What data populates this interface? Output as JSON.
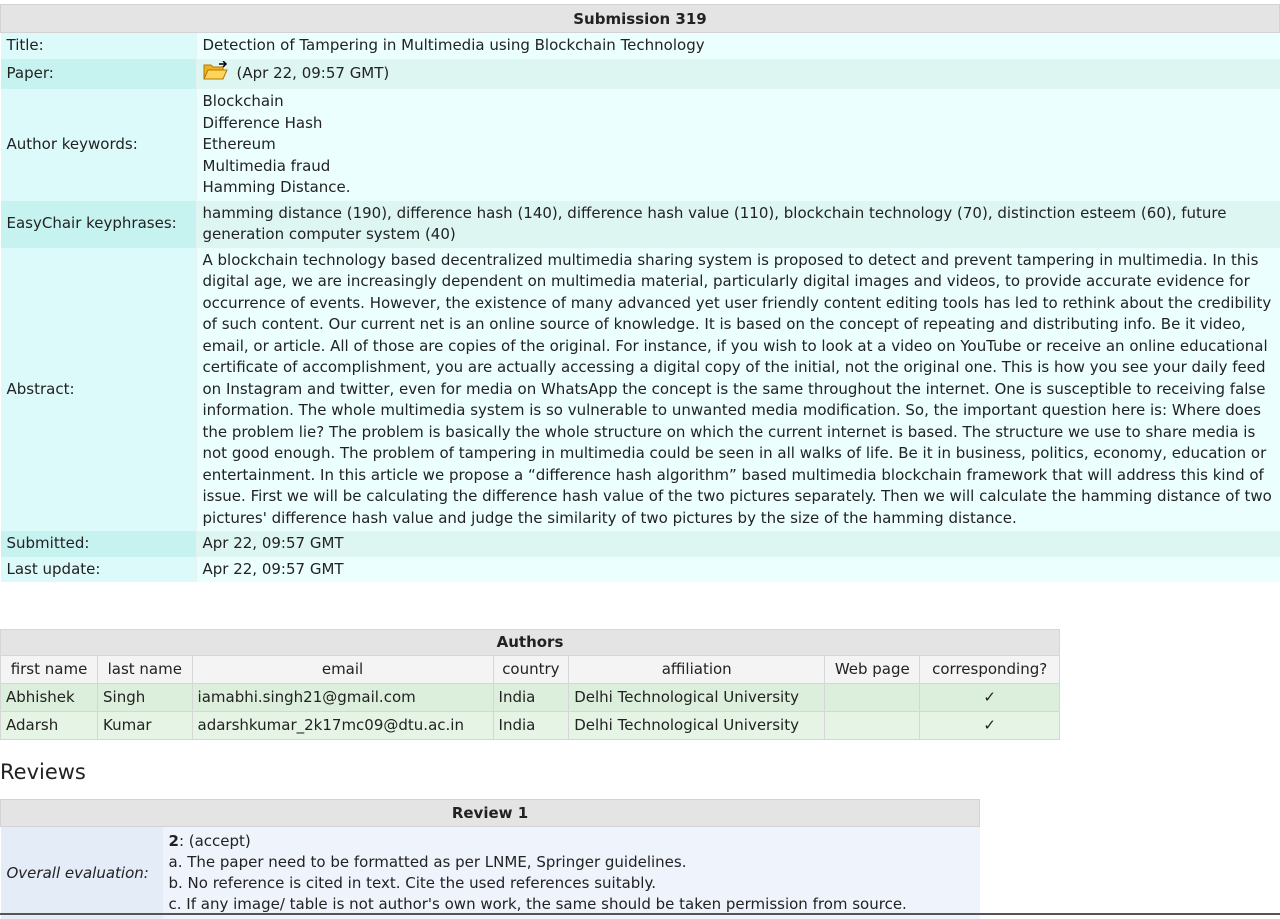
{
  "submission": {
    "title": "Submission 319",
    "fields": {
      "title_label": "Title:",
      "title_value": "Detection of Tampering in Multimedia using Blockchain Technology",
      "paper_label": "Paper:",
      "paper_value": "(Apr 22, 09:57 GMT)",
      "keywords_label": "Author keywords:",
      "keywords": [
        "Blockchain",
        "Difference Hash",
        "Ethereum",
        "Multimedia fraud",
        "Hamming Distance."
      ],
      "keyphrases_label": "EasyChair keyphrases:",
      "keyphrases_value": "hamming distance (190), difference hash (140), difference hash value (110), blockchain technology (70), distinction esteem (60), future generation computer system (40)",
      "abstract_label": "Abstract:",
      "abstract_value": "A blockchain technology based decentralized multimedia sharing system is proposed to detect and prevent tampering in multimedia. In this digital age, we are increasingly dependent on multimedia material, particularly digital images and videos, to provide accurate evidence for occurrence of events. However, the existence of many advanced yet user friendly content editing tools has led to rethink about the credibility of such content. Our current net is an online source of knowledge. It is based on the concept of repeating and distributing info. Be it video, email, or article. All of those are copies of the original. For instance, if you wish to look at a video on YouTube or receive an online educational certificate of accomplishment, you are actually accessing a digital copy of the initial, not the original one. This is how you see your daily feed on Instagram and twitter, even for media on WhatsApp the concept is the same throughout the internet. One is susceptible to receiving false information. The whole multimedia system is so vulnerable to unwanted media modification. So, the important question here is: Where does the problem lie? The problem is basically the whole structure on which the current internet is based. The structure we use to share media is not good enough. The problem of tampering in multimedia could be seen in all walks of life. Be it in business, politics, economy, education or entertainment. In this article we propose a “difference hash algorithm” based multimedia blockchain framework that will address this kind of issue. First we will be calculating the difference hash value of the two pictures separately. Then we will calculate the hamming distance of two pictures' difference hash value and judge the similarity of two pictures by the size of the hamming distance.",
      "submitted_label": "Submitted:",
      "submitted_value": "Apr 22, 09:57 GMT",
      "updated_label": "Last update:",
      "updated_value": "Apr 22, 09:57 GMT"
    }
  },
  "authors": {
    "caption": "Authors",
    "columns": [
      "first name",
      "last name",
      "email",
      "country",
      "affiliation",
      "Web page",
      "corresponding?"
    ],
    "rows": [
      [
        "Abhishek",
        "Singh",
        "iamabhi.singh21@gmail.com",
        "India",
        "Delhi Technological University",
        "",
        "✓"
      ],
      [
        "Adarsh",
        "Kumar",
        "adarshkumar_2k17mc09@dtu.ac.in",
        "India",
        "Delhi Technological University",
        "",
        "✓"
      ]
    ]
  },
  "reviews": {
    "heading": "Reviews",
    "review1": {
      "caption": "Review 1",
      "label": "Overall evaluation:",
      "score": "2",
      "score_text": ": (accept)",
      "lines": [
        "a. The paper need to be formatted as per LNME, Springer guidelines.",
        "b. No reference is cited in text. Cite the used references suitably.",
        "c. If any image/ table is not author's own work, the same should be taken permission from source."
      ]
    }
  },
  "icons": {
    "paper": "folder-open-icon"
  }
}
